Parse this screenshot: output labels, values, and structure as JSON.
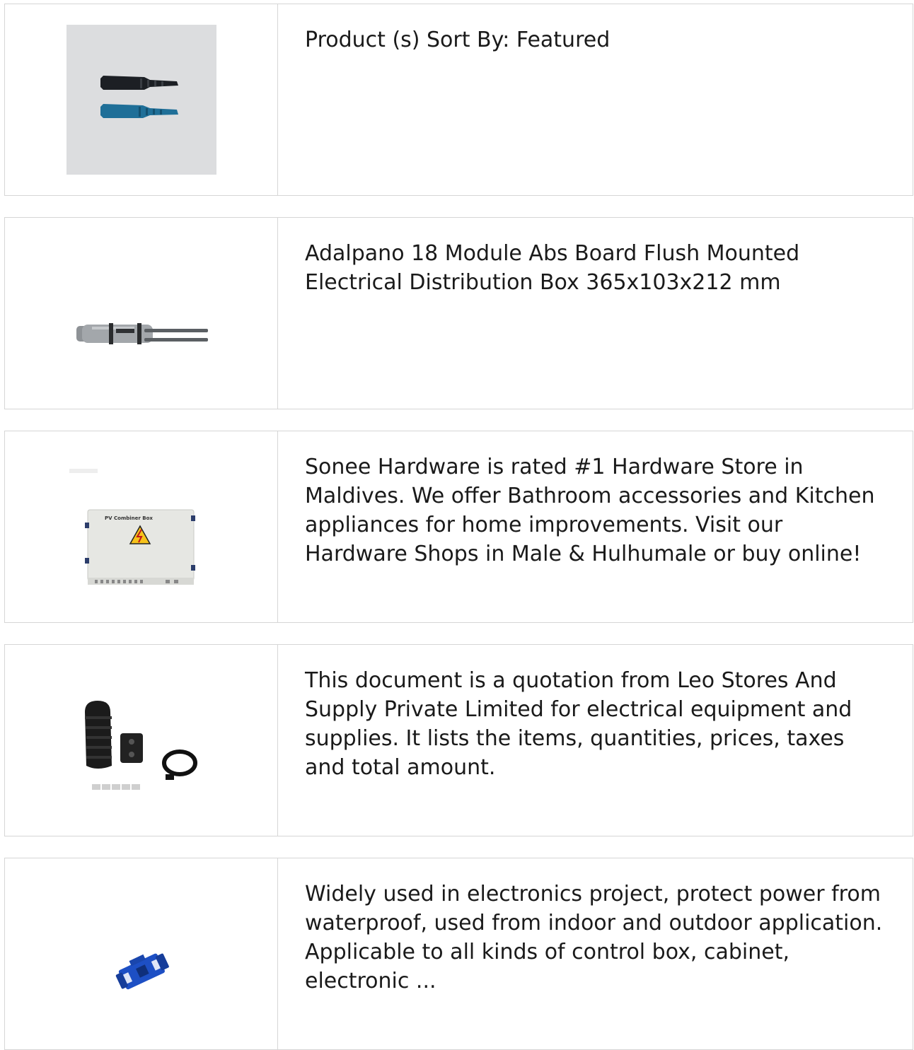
{
  "products": [
    {
      "image_icon": "black-blue-fiber-boots-image",
      "text": "Product (s) Sort By: Featured"
    },
    {
      "image_icon": "grey-connector-tool-image",
      "text": "Adalpano 18 Module Abs Board Flush Mounted Electrical Distribution Box 365x103x212 mm"
    },
    {
      "image_icon": "pv-combiner-box-image",
      "box_label": "PV Combiner Box",
      "text": "Sonee Hardware is rated #1 Hardware Store in Maldives. We offer Bathroom accessories and Kitchen appliances for home improvements. Visit our Hardware Shops in Male & Hulhumale or buy online!"
    },
    {
      "image_icon": "fiber-splice-closure-image",
      "text": "This document is a quotation from Leo Stores And Supply Private Limited for electrical equipment and supplies. It lists the items, quantities, prices, taxes and total amount."
    },
    {
      "image_icon": "blue-lc-duplex-adapter-image",
      "text": "Widely used in electronics project, protect power from waterproof, used from indoor and outdoor application. Applicable to all kinds of control box, cabinet, electronic ..."
    }
  ]
}
